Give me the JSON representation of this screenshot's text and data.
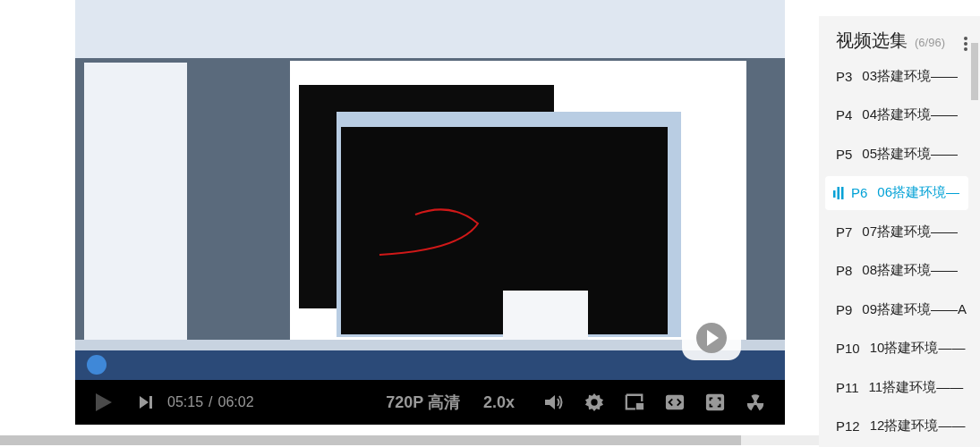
{
  "player": {
    "paused": true,
    "time_current": "05:15",
    "time_separator": "/",
    "time_total": "06:02",
    "quality": "720P 高清",
    "speed": "2.0x"
  },
  "playlist": {
    "title": "视频选集",
    "count": "(6/96)",
    "items": [
      {
        "part": "P3",
        "title": "03搭建环境——",
        "selected": false
      },
      {
        "part": "P4",
        "title": "04搭建环境——",
        "selected": false
      },
      {
        "part": "P5",
        "title": "05搭建环境——",
        "selected": false
      },
      {
        "part": "P6",
        "title": "06搭建环境—",
        "selected": true
      },
      {
        "part": "P7",
        "title": "07搭建环境——",
        "selected": false
      },
      {
        "part": "P8",
        "title": "08搭建环境——",
        "selected": false
      },
      {
        "part": "P9",
        "title": "09搭建环境——A",
        "selected": false
      },
      {
        "part": "P10",
        "title": "10搭建环境——",
        "selected": false
      },
      {
        "part": "P11",
        "title": "11搭建环境——",
        "selected": false
      },
      {
        "part": "P12",
        "title": "12搭建环境——",
        "selected": false
      }
    ]
  }
}
